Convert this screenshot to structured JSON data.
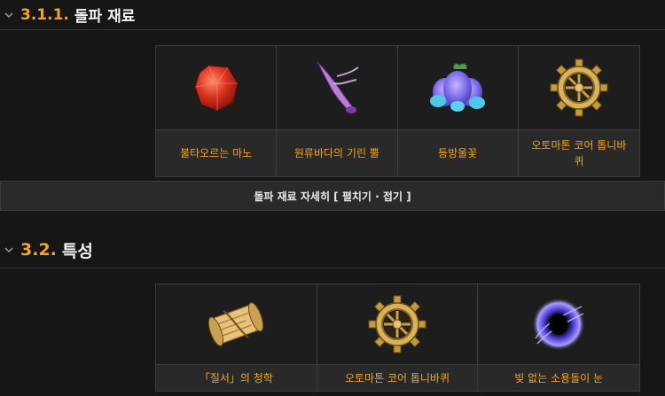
{
  "sections": [
    {
      "number": "3.1.1.",
      "title": "돌파 재료",
      "items": [
        {
          "name": "불타오르는 마노",
          "icon": "red-gem-icon"
        },
        {
          "name": "원류바다의 기린 뿔",
          "icon": "purple-horn-icon"
        },
        {
          "name": "등방울꽃",
          "icon": "blue-flower-icon"
        },
        {
          "name": "오토마톤 코어 톱니바퀴",
          "icon": "gear-icon"
        }
      ],
      "expand_label": "돌파 재료 자세히 [ 펼치기 · 접기 ]"
    },
    {
      "number": "3.2.",
      "title": "특성",
      "items": [
        {
          "name": "「질서」의 청학",
          "icon": "scroll-icon"
        },
        {
          "name": "오토마톤 코어 톱니바퀴",
          "icon": "gear-icon"
        },
        {
          "name": "빛 없는 소용돌이 눈",
          "icon": "vortex-eye-icon"
        }
      ]
    }
  ],
  "colors": {
    "accent": "#f0a52a",
    "background": "#161616",
    "cell_label_bg": "#292929",
    "border": "#3c3c3c"
  }
}
